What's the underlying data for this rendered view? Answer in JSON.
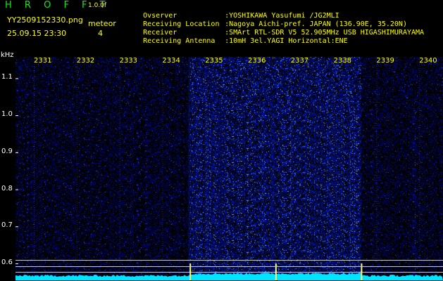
{
  "header": {
    "app_title": "H R O F F T",
    "version": "1.0.0f",
    "file_name": "YY2509152330.png",
    "date_time": "25.09.15 23:30",
    "event_type": "meteor",
    "event_count": "4"
  },
  "station": [
    {
      "key": "Ovserver",
      "value": ":YOSHIKAWA Yasufumi /JG2MLI"
    },
    {
      "key": "Receiving Location",
      "value": ":Nagoya Aichi-pref. JAPAN (136.90E, 35.20N)"
    },
    {
      "key": "Receiver",
      "value": ":SMArt RTL-SDR V5 52.905MHz USB HIGASHIMURAYAMA"
    },
    {
      "key": "Receiving Antenna",
      "value": ":10mH 3el.YAGI Horizontal:ENE"
    }
  ],
  "colors": {
    "accent_yellow": "#ffff00",
    "title_green": "#19e619",
    "waterfall_blue": "#0a2a8a",
    "trace_cyan": "#00e5ff"
  },
  "chart_data": {
    "type": "heatmap",
    "y_axis_label": "kHz",
    "x_tick_labels": [
      "2331",
      "2332",
      "2333",
      "2334",
      "2335",
      "2336",
      "2337",
      "2338",
      "2339",
      "2340"
    ],
    "y_tick_labels": [
      "1.1",
      "1.0",
      "0.9",
      "0.8",
      "0.7",
      "0.6"
    ],
    "y_ticks": [
      1.1,
      1.0,
      0.9,
      0.8,
      0.7,
      0.6
    ],
    "ylim": [
      0.6,
      1.15
    ],
    "bright_interval_start": "2335",
    "bright_interval_end": "2339",
    "meteor_marks": [
      "2335",
      "2337",
      "2339"
    ],
    "grid": true
  }
}
